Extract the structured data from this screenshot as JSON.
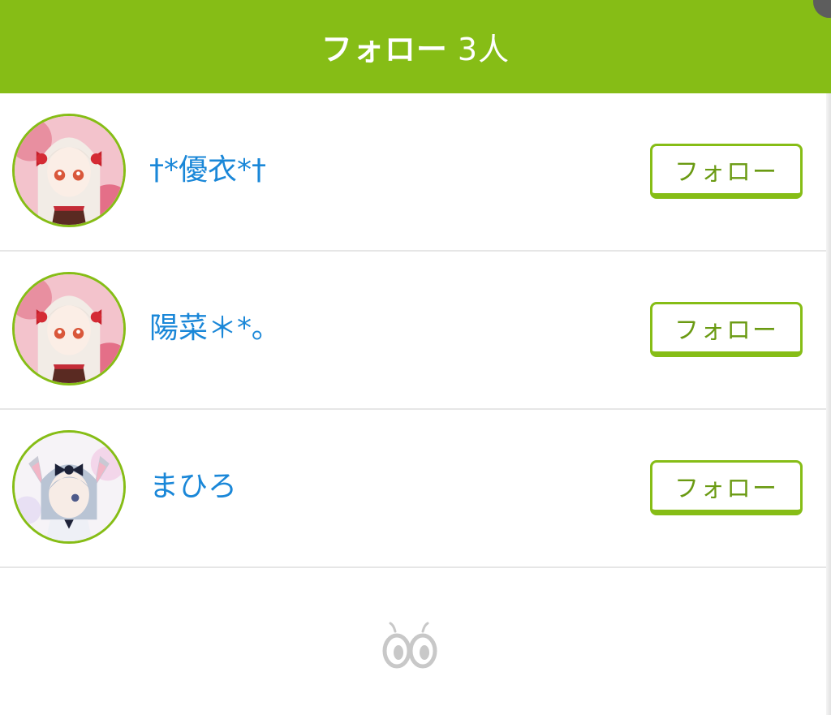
{
  "header": {
    "title": "フォロー",
    "count": "3人"
  },
  "colors": {
    "accent_green": "#86bd16",
    "username_blue": "#1a87d8"
  },
  "users": [
    {
      "name": "†*優衣*†",
      "avatar_icon": "avatar-icon",
      "follow_label": "フォロー"
    },
    {
      "name": "陽菜＊*｡",
      "avatar_icon": "avatar-icon",
      "follow_label": "フォロー"
    },
    {
      "name": "まひろ",
      "avatar_icon": "avatar-icon",
      "follow_label": "フォロー"
    }
  ],
  "footer": {
    "indicator_icon": "eyes-loading-icon"
  }
}
